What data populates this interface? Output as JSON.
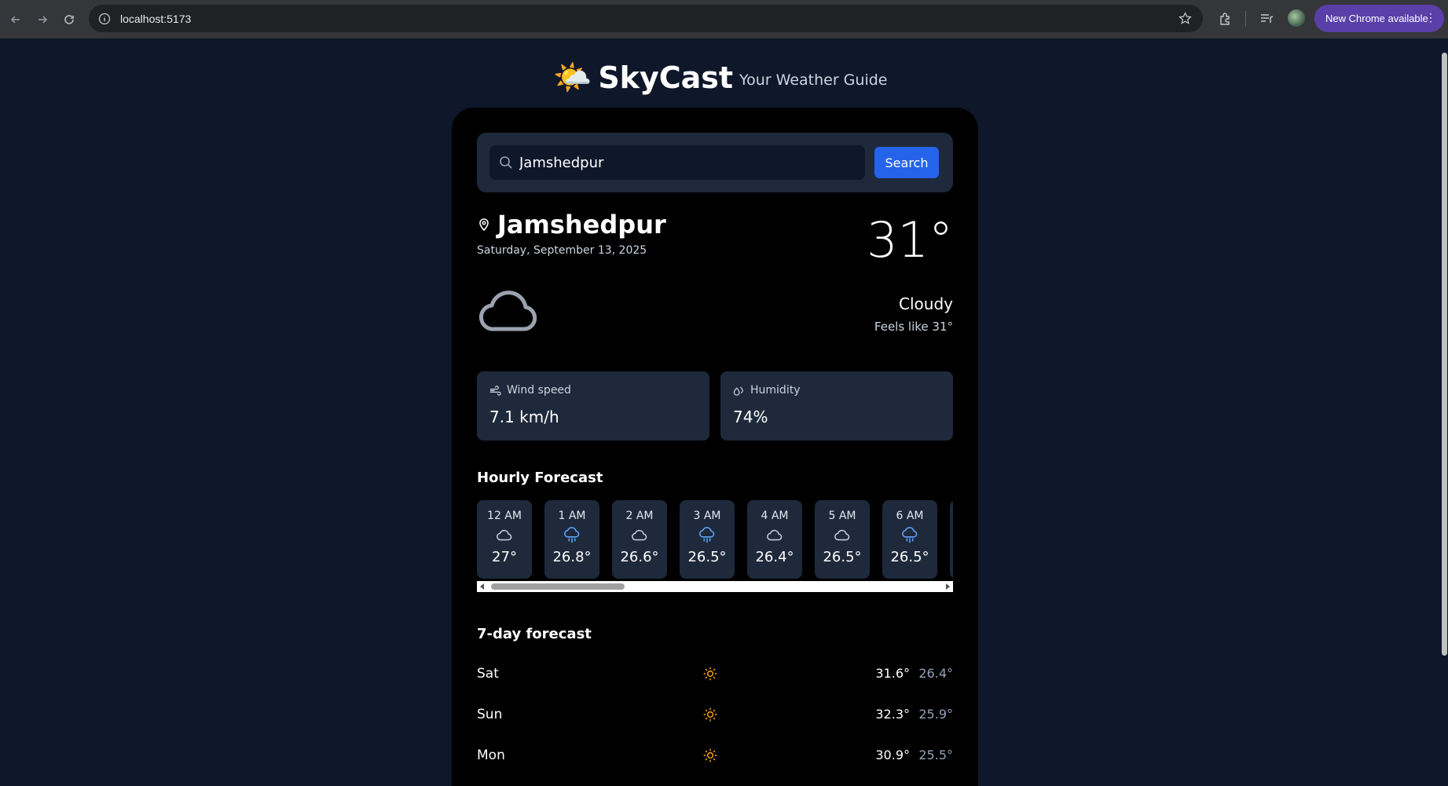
{
  "browser": {
    "url": "localhost:5173",
    "update_label": "New Chrome available"
  },
  "app": {
    "logo_emoji": "🌤️",
    "title": "SkyCast",
    "subtitle": "Your Weather Guide"
  },
  "search": {
    "value": "Jamshedpur",
    "button_label": "Search"
  },
  "current": {
    "city": "Jamshedpur",
    "date": "Saturday, September 13, 2025",
    "temperature": "31°",
    "condition": "Cloudy",
    "feels_like": "Feels like 31°",
    "icon": "cloud-icon"
  },
  "stats": {
    "wind_label": "Wind speed",
    "wind_value": "7.1 km/h",
    "humidity_label": "Humidity",
    "humidity_value": "74%"
  },
  "hourly": {
    "title": "Hourly Forecast",
    "items": [
      {
        "time": "12 AM",
        "icon": "cloud-icon",
        "temp": "27°"
      },
      {
        "time": "1 AM",
        "icon": "rain-icon",
        "temp": "26.8°"
      },
      {
        "time": "2 AM",
        "icon": "cloud-icon",
        "temp": "26.6°"
      },
      {
        "time": "3 AM",
        "icon": "rain-icon",
        "temp": "26.5°"
      },
      {
        "time": "4 AM",
        "icon": "cloud-icon",
        "temp": "26.4°"
      },
      {
        "time": "5 AM",
        "icon": "cloud-icon",
        "temp": "26.5°"
      },
      {
        "time": "6 AM",
        "icon": "rain-icon",
        "temp": "26.5°"
      }
    ]
  },
  "daily": {
    "title": "7-day forecast",
    "items": [
      {
        "day": "Sat",
        "icon": "sun-icon",
        "high": "31.6°",
        "low": "26.4°"
      },
      {
        "day": "Sun",
        "icon": "sun-icon",
        "high": "32.3°",
        "low": "25.9°"
      },
      {
        "day": "Mon",
        "icon": "sun-icon",
        "high": "30.9°",
        "low": "25.5°"
      }
    ]
  },
  "colors": {
    "background": "#0f172a",
    "card": "#000000",
    "panel": "#1e293b",
    "accent": "#2563eb",
    "rain_icon": "#60a5fa",
    "sun_icon": "#f59e0b"
  }
}
